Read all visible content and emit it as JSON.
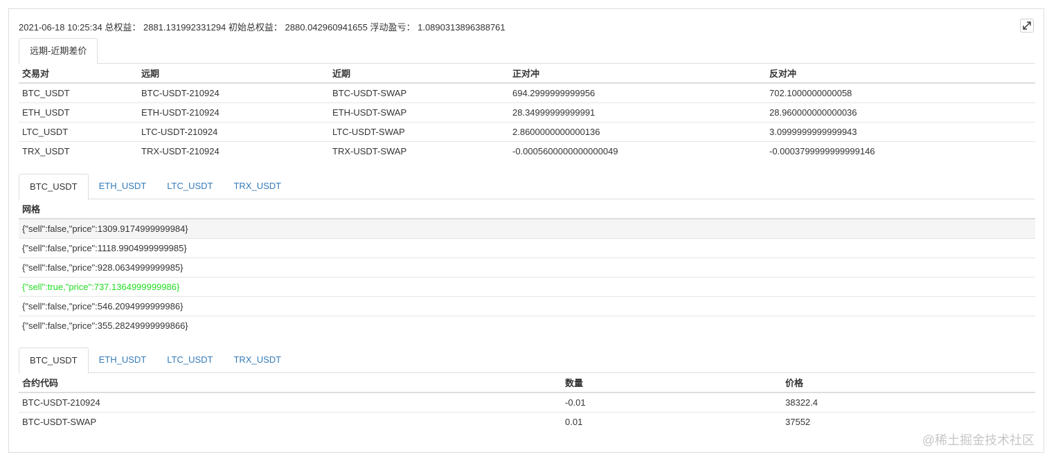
{
  "header": {
    "datetime": "2021-06-18 10:25:34",
    "total_equity_label": "总权益：",
    "total_equity": "2881.131992331294",
    "initial_equity_label": "初始总权益：",
    "initial_equity": "2880.042960941655",
    "floating_pnl_label": "浮动盈亏：",
    "floating_pnl": "1.0890313896388761"
  },
  "spread": {
    "tab_label": "远期-近期差价",
    "columns": [
      "交易对",
      "远期",
      "近期",
      "正对冲",
      "反对冲"
    ],
    "rows": [
      [
        "BTC_USDT",
        "BTC-USDT-210924",
        "BTC-USDT-SWAP",
        "694.2999999999956",
        "702.1000000000058"
      ],
      [
        "ETH_USDT",
        "ETH-USDT-210924",
        "ETH-USDT-SWAP",
        "28.34999999999991",
        "28.960000000000036"
      ],
      [
        "LTC_USDT",
        "LTC-USDT-210924",
        "LTC-USDT-SWAP",
        "2.8600000000000136",
        "3.0999999999999943"
      ],
      [
        "TRX_USDT",
        "TRX-USDT-210924",
        "TRX-USDT-SWAP",
        "-0.0005600000000000049",
        "-0.0003799999999999146"
      ]
    ]
  },
  "grid": {
    "tabs": [
      "BTC_USDT",
      "ETH_USDT",
      "LTC_USDT",
      "TRX_USDT"
    ],
    "column": "网格",
    "rows": [
      "{\"sell\":false,\"price\":1309.9174999999984}",
      "{\"sell\":false,\"price\":1118.9904999999985}",
      "{\"sell\":false,\"price\":928.0634999999985}",
      "{\"sell\":true,\"price\":737.1364999999986}",
      "{\"sell\":false,\"price\":546.2094999999986}",
      "{\"sell\":false,\"price\":355.28249999999866}"
    ],
    "highlight_color": "#22dd22"
  },
  "positions": {
    "tabs": [
      "BTC_USDT",
      "ETH_USDT",
      "LTC_USDT",
      "TRX_USDT"
    ],
    "columns": [
      "合约代码",
      "数量",
      "价格"
    ],
    "rows": [
      [
        "BTC-USDT-210924",
        "-0.01",
        "38322.4"
      ],
      [
        "BTC-USDT-SWAP",
        "0.01",
        "37552"
      ]
    ]
  },
  "watermark": "@稀土掘金技术社区",
  "icons": {
    "expand": "expand-icon"
  },
  "colors": {
    "link": "#337ab7",
    "border": "#dddddd"
  }
}
